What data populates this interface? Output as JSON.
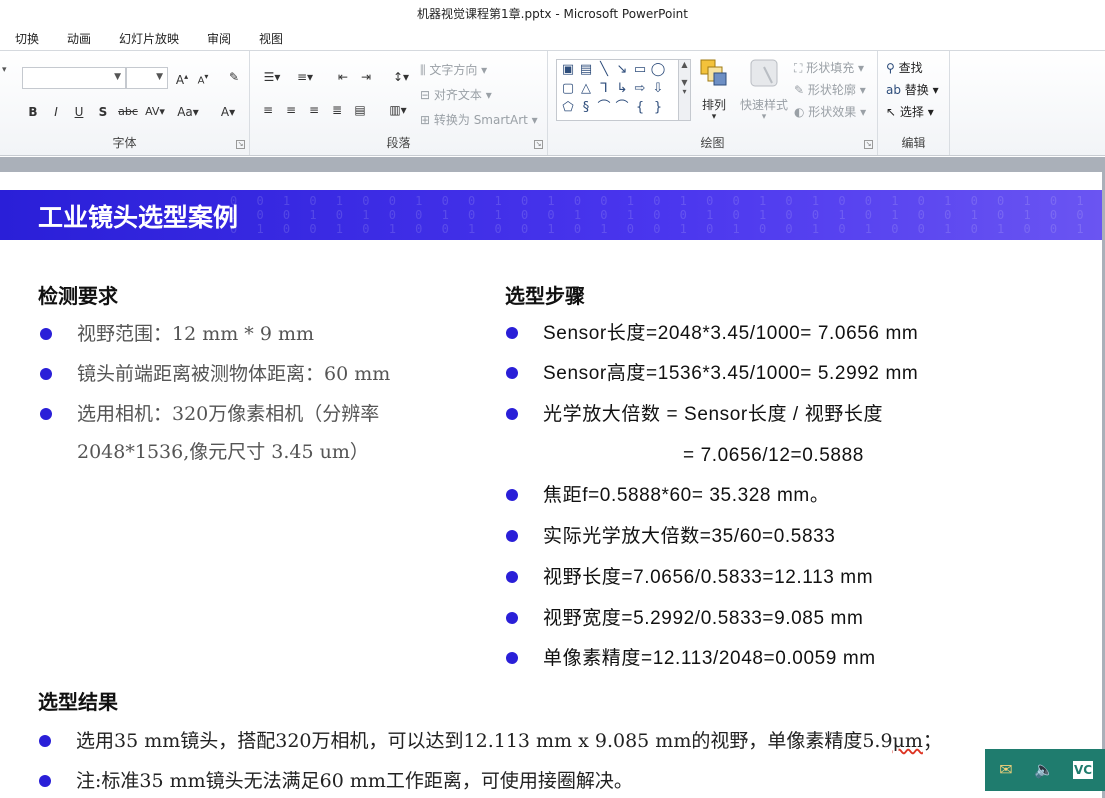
{
  "window": {
    "title": "机器视觉课程第1章.pptx - Microsoft PowerPoint"
  },
  "menu": {
    "tabs": [
      "切换",
      "动画",
      "幻灯片放映",
      "审阅",
      "视图"
    ]
  },
  "ribbon": {
    "font_group": {
      "label": "字体",
      "font_name": "",
      "font_size": ""
    },
    "paragraph_group": {
      "label": "段落",
      "text_direction": "文字方向",
      "align_text": "对齐文本",
      "smartart": "转换为 SmartArt"
    },
    "drawing_group": {
      "label": "绘图",
      "arrange": "排列",
      "quick_styles": "快速样式",
      "shape_fill": "形状填充",
      "shape_outline": "形状轮廓",
      "shape_effects": "形状效果"
    },
    "editing_group": {
      "label": "编辑",
      "find": "查找",
      "replace": "替换",
      "select": "选择"
    }
  },
  "slide": {
    "title": "工业镜头选型案例",
    "requirements": {
      "heading": "检测要求",
      "items": [
        "视野范围：12 mm * 9 mm",
        "镜头前端距离被测物体距离：60 mm",
        "选用相机：320万像素相机（分辨率",
        "2048*1536,像元尺寸 3.45 um）"
      ]
    },
    "steps": {
      "heading": "选型步骤",
      "items": [
        "Sensor长度=2048*3.45/1000= 7.0656 mm",
        "Sensor高度=1536*3.45/1000= 5.2992 mm",
        "光学放大倍数 = Sensor长度 / 视野长度",
        "= 7.0656/12=0.5888",
        "焦距f=0.5888*60= 35.328 mm。",
        "实际光学放大倍数=35/60=0.5833",
        "视野长度=7.0656/0.5833=12.113 mm",
        "视野宽度=5.2992/0.5833=9.085 mm",
        "单像素精度=12.113/2048=0.0059 mm"
      ]
    },
    "result": {
      "heading": "选型结果",
      "item1_main": "选用35 mm镜头，搭配320万相机，可以达到12.113 mm x  9.085 mm的视野，单像素精度5.9",
      "item1_unit": "μm",
      "item1_end": "；",
      "item2": "注:标准35 mm镜头无法满足60 mm工作距离，可使用接圈解决。"
    }
  },
  "tray": {
    "icons": [
      "mail-icon",
      "speaker-icon",
      "vc-icon"
    ],
    "vc_text": "VC"
  },
  "colors": {
    "banner": "#2a1fd8",
    "bullet": "#2a1fd8",
    "tray": "#1f7c6e"
  }
}
